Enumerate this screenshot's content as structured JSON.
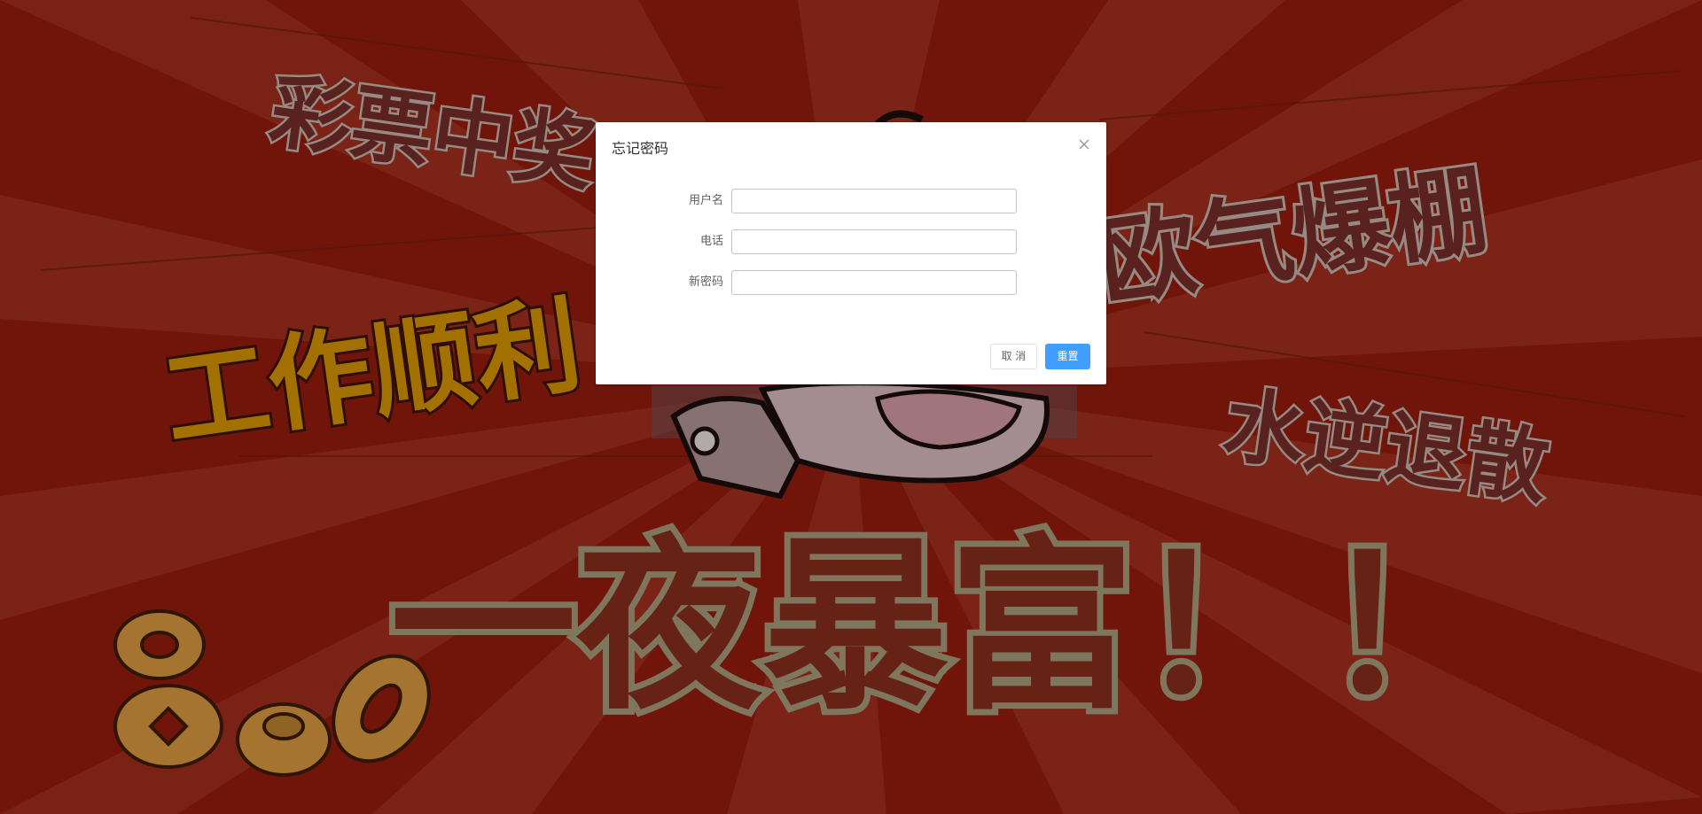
{
  "background": {
    "slogans": [
      "彩票中奖",
      "欧气爆棚",
      "工作顺利",
      "水逆退散",
      "一夜暴富！！"
    ],
    "colors": {
      "base": "#8a1a0e",
      "ray": "#a1392a",
      "slogan_fill": "#6e2a25",
      "slogan_stroke": "#b8a9a0",
      "gold_fill": "#c78a00",
      "coin": "#c98e3b"
    }
  },
  "dialog": {
    "title": "忘记密码",
    "close_icon": "close-icon",
    "fields": {
      "username": {
        "label": "用户名",
        "value": "",
        "placeholder": ""
      },
      "phone": {
        "label": "电话",
        "value": "",
        "placeholder": ""
      },
      "new_password": {
        "label": "新密码",
        "value": "",
        "placeholder": ""
      }
    },
    "buttons": {
      "cancel": "取 消",
      "confirm": "重置"
    },
    "colors": {
      "primary": "#409eff"
    }
  }
}
